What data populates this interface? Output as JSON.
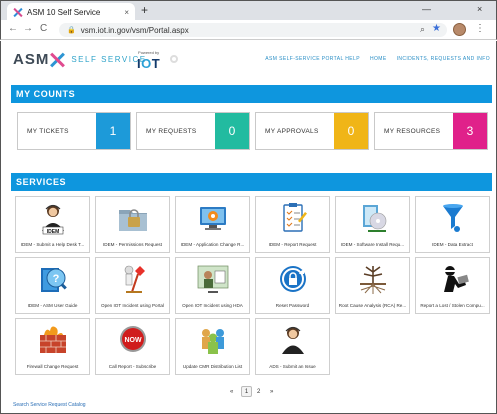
{
  "browser": {
    "tab_title": "ASM 10 Self Service",
    "tab_close": "×",
    "new_tab": "+",
    "url": "vsm.iot.in.gov/vsm/Portal.aspx",
    "back": "←",
    "forward": "→",
    "reload": "C",
    "lock": "🔒",
    "search_glyph": "⌕",
    "star_glyph": "★",
    "kebab_glyph": "⋮",
    "win_minimize": "—",
    "win_close": "×"
  },
  "header": {
    "brand_asm": "ASM",
    "brand_self_service": "SELF SERVICE",
    "powered_by": "Powered by",
    "iot_left": "I",
    "iot_o": "O",
    "iot_right": "T",
    "nav": [
      "ASM SELF-SERVICE PORTAL HELP",
      "HOME",
      "INCIDENTS, REQUESTS AND INFO"
    ]
  },
  "counts": {
    "title": "MY COUNTS",
    "cards": [
      {
        "label": "MY TICKETS",
        "value": "1",
        "color": "#1d9ad9"
      },
      {
        "label": "MY REQUESTS",
        "value": "0",
        "color": "#22bba0"
      },
      {
        "label": "MY APPROVALS",
        "value": "0",
        "color": "#f0b517"
      },
      {
        "label": "MY RESOURCES",
        "value": "3",
        "color": "#e0218a"
      }
    ]
  },
  "services": {
    "title": "SERVICES",
    "tiles": [
      {
        "label": "IDEM - Submit a Help Desk T...",
        "icon": "help-desk-agent-icon",
        "badge": "IDEM"
      },
      {
        "label": "IDEM - Permissions Request",
        "icon": "folder-lock-icon"
      },
      {
        "label": "IDEM - Application Change R...",
        "icon": "gear-monitor-icon"
      },
      {
        "label": "IDEM - Report Request",
        "icon": "clipboard-checklist-icon"
      },
      {
        "label": "IDEM - Software Install Requ...",
        "icon": "software-install-icon"
      },
      {
        "label": "IDEM - Data Extract",
        "icon": "data-extract-funnel-icon"
      },
      {
        "label": "IDEM - ASM User Guide",
        "icon": "help-book-icon"
      },
      {
        "label": "Open IOT Incident using Portal",
        "icon": "incident-figure-icon"
      },
      {
        "label": "Open IOT Incident using HDA",
        "icon": "hda-incident-icon"
      },
      {
        "label": "Reset Password",
        "icon": "reset-password-icon"
      },
      {
        "label": "Root Cause Analysis (RCA) Re...",
        "icon": "root-tree-icon"
      },
      {
        "label": "Report a Lost / Stolen Compu...",
        "icon": "thief-laptop-icon"
      },
      {
        "label": "Firewall Change Request",
        "icon": "firewall-icon"
      },
      {
        "label": "Call Report - Subscribe",
        "icon": "now-button-icon",
        "badge": "NOW"
      },
      {
        "label": "Update CMR Distribution List",
        "icon": "distribution-group-icon"
      },
      {
        "label": "ADS - Submit an Issue",
        "icon": "ads-agent-icon"
      }
    ]
  },
  "pagination": {
    "prev": "«",
    "pages": [
      "1",
      "2"
    ],
    "next": "»"
  },
  "footer": {
    "search_link": "Search Service Request Catalog"
  }
}
